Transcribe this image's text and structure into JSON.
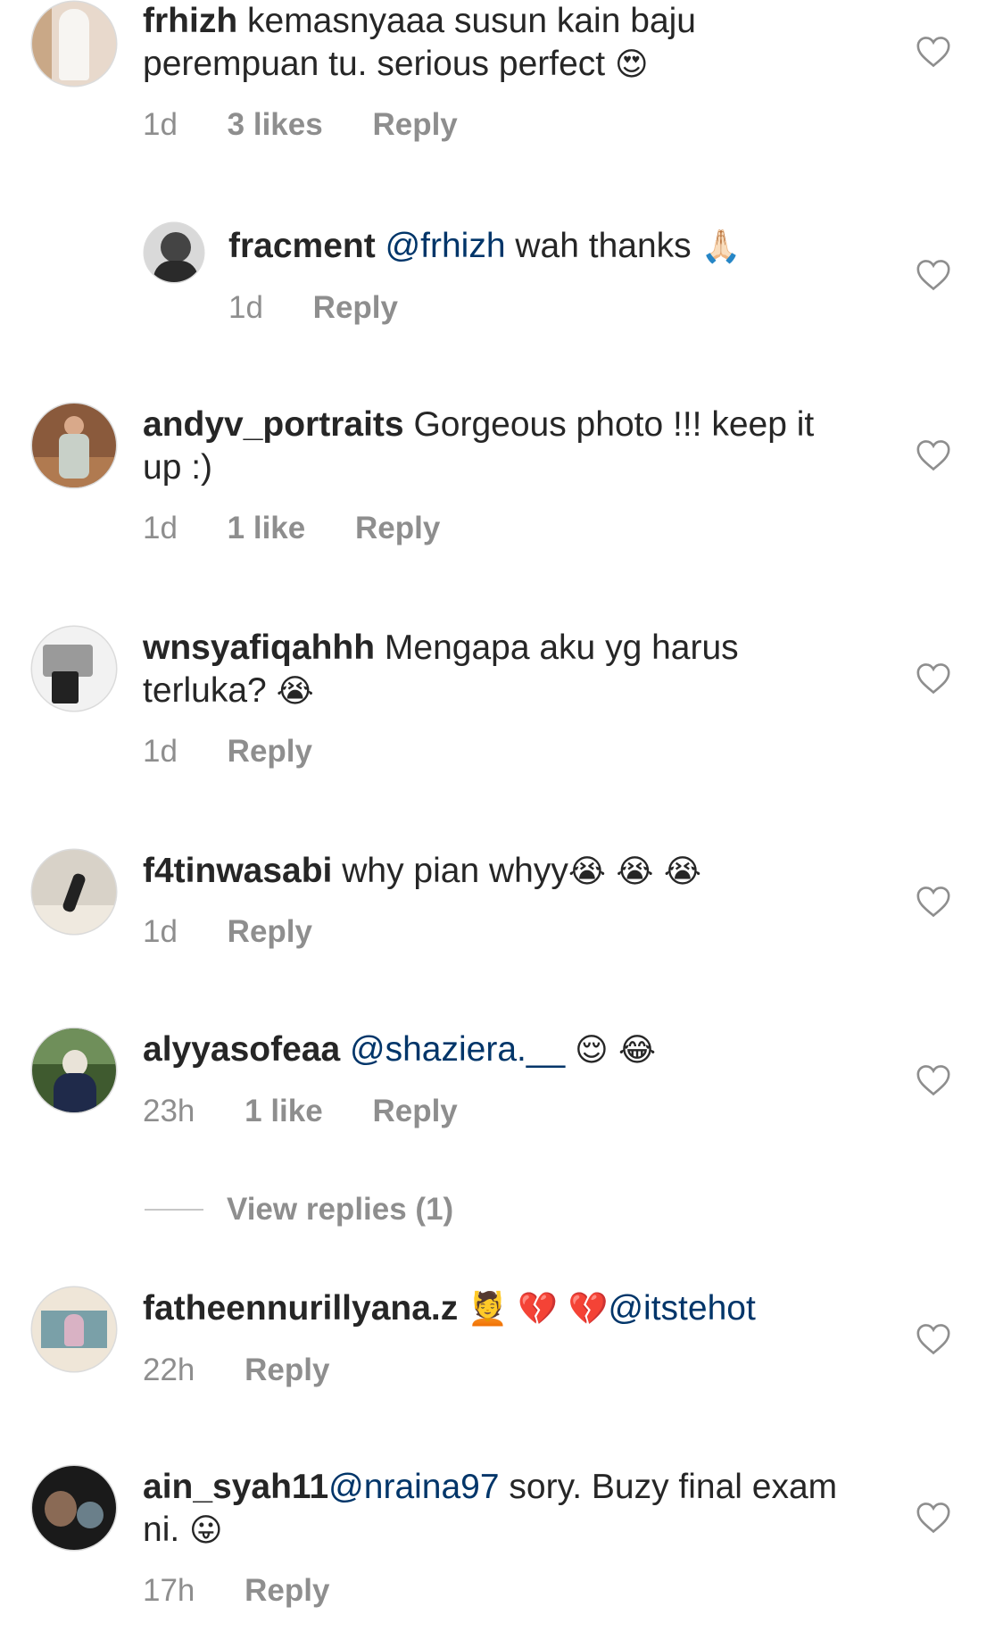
{
  "comments": [
    {
      "username": "frhizh",
      "text": "kemasnyaaa susun kain baju perempuan tu. serious perfect",
      "emoji": "😍",
      "time": "1d",
      "likes": "3 likes",
      "reply_label": "Reply",
      "avatar_bg": "#e8d9cc"
    },
    {
      "username": "fracment",
      "mention": "@frhizh",
      "text": "wah thanks",
      "emoji": "🙏🏻",
      "time": "1d",
      "reply_label": "Reply",
      "avatar_bg": "#d9d9d9"
    },
    {
      "username": "andyv_portraits",
      "text": "Gorgeous photo !!! keep it up :)",
      "time": "1d",
      "likes": "1 like",
      "reply_label": "Reply",
      "avatar_bg": "#8a5a3c"
    },
    {
      "username": "wnsyafiqahhh",
      "text": "Mengapa aku yg harus terluka?",
      "emoji": "😭",
      "time": "1d",
      "reply_label": "Reply",
      "avatar_bg": "#f2f2f2"
    },
    {
      "username": "f4tinwasabi",
      "text": "why pian whyy",
      "emoji": "😭 😭 😭",
      "time": "1d",
      "reply_label": "Reply",
      "avatar_bg": "#d8d2c8"
    },
    {
      "username": "alyyasofeaa",
      "mention": "@shaziera.__",
      "emoji": "😌 😂",
      "time": "23h",
      "likes": "1 like",
      "reply_label": "Reply",
      "avatar_bg": "#3f5a2f"
    },
    {
      "username": "fatheennurillyana.z",
      "emoji": "💆 💔 💔",
      "mention": "@itstehot",
      "time": "22h",
      "reply_label": "Reply",
      "avatar_bg": "#efe6d8"
    },
    {
      "username": "ain_syah11",
      "mention": "@nraina97",
      "text": "sory. Buzy final exam ni.",
      "emoji": "😛",
      "time": "17h",
      "reply_label": "Reply",
      "avatar_bg": "#1a1a1a"
    }
  ],
  "view_replies": "View replies (1)",
  "colors": {
    "text": "#262626",
    "meta": "#8e8e8e",
    "mention": "#003569",
    "divider": "#c7c7c7"
  },
  "icons": {
    "like": "heart-outline-icon"
  }
}
